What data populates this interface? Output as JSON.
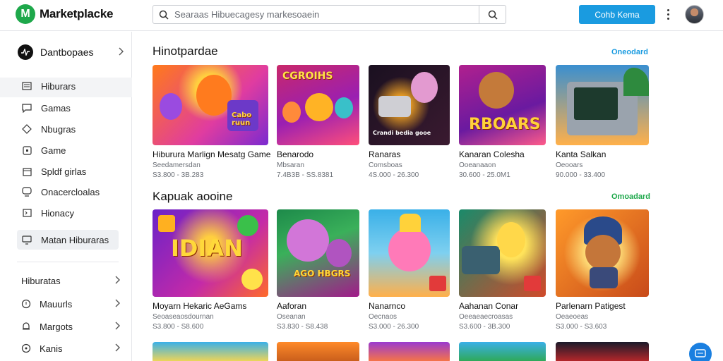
{
  "app": {
    "logo_letter": "M",
    "name": "Marketplacke"
  },
  "search": {
    "placeholder": "Searaas Hibuecagesy markesoaein"
  },
  "header": {
    "cta_label": "Cohb Kema"
  },
  "sidebar": {
    "head_label": "Dantbopaes",
    "items": [
      {
        "label": "Hiburars",
        "icon": "list-icon"
      },
      {
        "label": "Gamas",
        "icon": "chat-icon"
      },
      {
        "label": "Nbugras",
        "icon": "tag-icon"
      },
      {
        "label": "Game",
        "icon": "square-icon"
      },
      {
        "label": "Spldf girlas",
        "icon": "calendar-icon"
      },
      {
        "label": "Onacercloalas",
        "icon": "chat-bubble-icon"
      },
      {
        "label": "Hionacy",
        "icon": "box-icon"
      }
    ],
    "active_item": {
      "label": "Matan Hiburaras",
      "icon": "dashboard-icon"
    },
    "expandables": [
      {
        "label": "Hiburatas",
        "icon": ""
      },
      {
        "label": "Mauurls",
        "icon": "help-icon"
      },
      {
        "label": "Margots",
        "icon": "bell-icon"
      },
      {
        "label": "Kanis",
        "icon": "circle-icon"
      }
    ]
  },
  "sections": [
    {
      "title": "Hinotpardae",
      "see_all": "Oneodard",
      "see_all_color": "#1a9be0",
      "cards": [
        {
          "title": "Hiburura Marlign Mesatg Game",
          "sub": "Seedamersdan",
          "price": "S3.800 - 3B.283"
        },
        {
          "title": "Benarodo",
          "sub": "Mbsaran",
          "price": "7.4B3B - SS.8381"
        },
        {
          "title": "Ranaras",
          "sub": "Comsboas",
          "price": "4S.000 - 26.300"
        },
        {
          "title": "Kanaran Colesha",
          "sub": "Ooeanaaon",
          "price": "30.600 - 25.0M1"
        },
        {
          "title": "Kanta Salkan",
          "sub": "Oeooars",
          "price": "90.000 - 33.400"
        }
      ]
    },
    {
      "title": "Kapuak aooine",
      "see_all": "Omoadard",
      "see_all_color": "#1ea84b",
      "cards": [
        {
          "title": "Moyarn Hekaric AeGams",
          "sub": "Seoaseaosdournan",
          "price": "S3.800 - S8.600"
        },
        {
          "title": "Aaforan",
          "sub": "Oseanan",
          "price": "S3.830 - S8.438"
        },
        {
          "title": "Nanarnco",
          "sub": "Oecnaos",
          "price": "S3.000 - 26.300"
        },
        {
          "title": "Aahanan Conar",
          "sub": "Oeeaeaecroasas",
          "price": "S3.600 - 3B.300"
        },
        {
          "title": "Parlenarn Patigest",
          "sub": "Oeaeoeas",
          "price": "S3.000 - S3.603"
        }
      ]
    }
  ],
  "thumb_words": [
    "Cabo ruun",
    "CGROIHS",
    "Crandi bedia gooe",
    "RBOARS",
    "",
    "IDIAN",
    "AGO HBGRS",
    "",
    "",
    ""
  ],
  "colors": {
    "accent": "#1a9be0",
    "brand": "#1ea84b"
  }
}
